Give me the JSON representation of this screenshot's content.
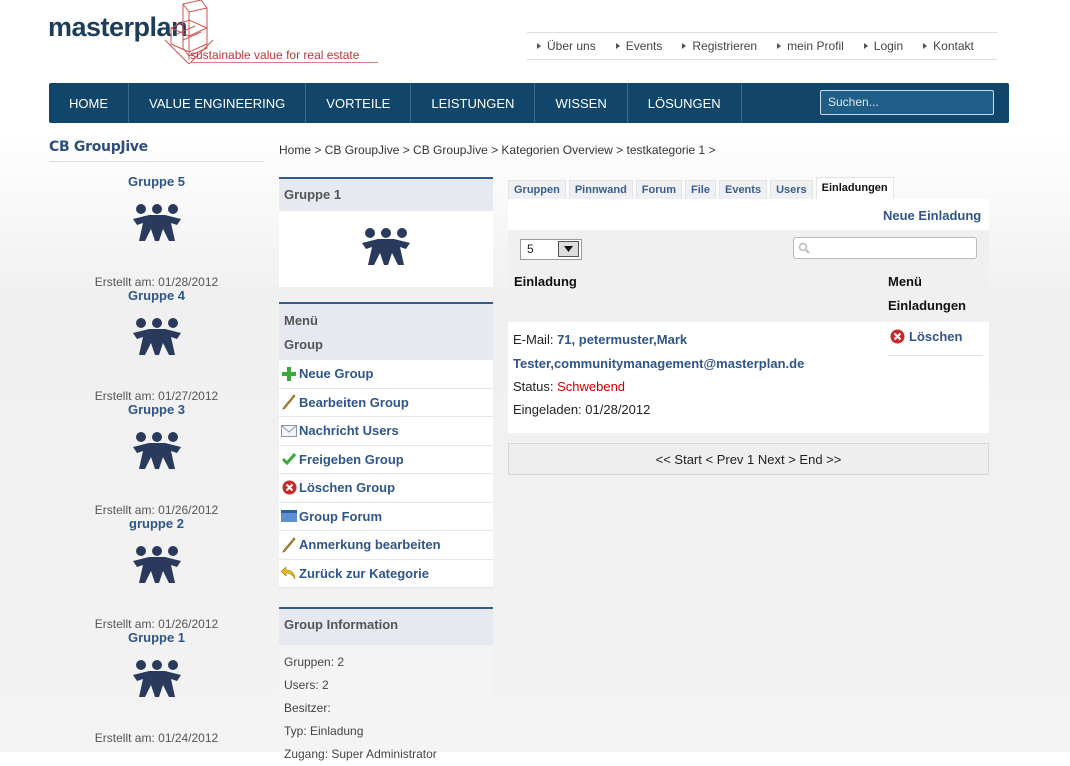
{
  "header": {
    "logo_text": "masterplan",
    "tagline": "sustainable value for real estate",
    "top_links": [
      "Über uns",
      "Events",
      "Registrieren",
      "mein Profil",
      "Login",
      "Kontakt"
    ]
  },
  "main_nav": {
    "items": [
      "HOME",
      "VALUE ENGINEERING",
      "VORTEILE",
      "LEISTUNGEN",
      "WISSEN",
      "LÖSUNGEN"
    ],
    "search_placeholder": "Suchen..."
  },
  "sidebar": {
    "title": "CB GroupJive",
    "groups": [
      {
        "name": "Gruppe 5",
        "created": "Erstellt am: 01/28/2012"
      },
      {
        "name": "Gruppe 4",
        "created": "Erstellt am: 01/27/2012"
      },
      {
        "name": "Gruppe 3",
        "created": "Erstellt am: 01/26/2012"
      },
      {
        "name": "gruppe 2",
        "created": "Erstellt am: 01/26/2012"
      },
      {
        "name": "Gruppe 1",
        "created": "Erstellt am: 01/24/2012"
      }
    ]
  },
  "breadcrumb": "Home > CB GroupJive > CB GroupJive > Kategorien Overview > testkategorie 1 >",
  "group_panel": {
    "title": "Gruppe 1",
    "menu_title_1": "Menü",
    "menu_title_2": "Group",
    "menu_items": [
      {
        "label": "Neue Group",
        "icon": "plus-icon"
      },
      {
        "label": "Bearbeiten Group",
        "icon": "pencil-icon"
      },
      {
        "label": "Nachricht Users",
        "icon": "envelope-icon"
      },
      {
        "label": "Freigeben Group",
        "icon": "checkmark-icon"
      },
      {
        "label": "Löschen Group",
        "icon": "delete-icon"
      },
      {
        "label": "Group Forum",
        "icon": "forum-icon"
      },
      {
        "label": "Anmerkung bearbeiten",
        "icon": "pencil-icon"
      },
      {
        "label": "Zurück zur Kategorie",
        "icon": "back-arrow-icon"
      }
    ],
    "info_title": "Group Information",
    "info_lines": [
      "Gruppen: 2",
      "Users: 2",
      "Besitzer:",
      "Typ: Einladung",
      "Zugang: Super Administrator"
    ]
  },
  "tabs": [
    "Gruppen",
    "Pinnwand",
    "Forum",
    "File",
    "Events",
    "Users",
    "Einladungen"
  ],
  "active_tab": "Einladungen",
  "invites": {
    "new_label": "Neue Einladung",
    "page_size": "5",
    "col_invite": "Einladung",
    "col_menu_1": "Menü",
    "col_menu_2": "Einladungen",
    "email_label": "E-Mail:",
    "email_value_1": "71, petermuster,Mark",
    "email_value_2": "Tester,communitymanagement@masterplan.de",
    "status_label": "Status:",
    "status_value": "Schwebend",
    "invited": "Eingeladen: 01/28/2012",
    "delete_label": "Löschen"
  },
  "pager": "<< Start < Prev 1 Next > End >>",
  "colors": {
    "nav_bg": "#11466a",
    "link": "#2f5589",
    "status_pending": "#cc0000",
    "tagline": "#b23a3a"
  }
}
